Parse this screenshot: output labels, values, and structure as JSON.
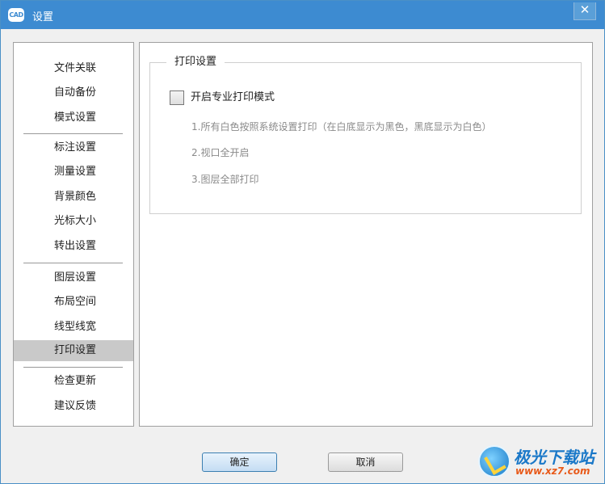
{
  "window": {
    "logo_text": "CAD",
    "title": "设置",
    "close_glyph": "✕"
  },
  "sidebar": {
    "groups": [
      [
        "文件关联",
        "自动备份",
        "模式设置"
      ],
      [
        "标注设置",
        "测量设置",
        "背景颜色",
        "光标大小",
        "转出设置"
      ],
      [
        "图层设置",
        "布局空间",
        "线型线宽",
        "打印设置"
      ],
      [
        "检查更新",
        "建议反馈"
      ]
    ],
    "items": [
      {
        "label": "文件关联",
        "id": "file-association"
      },
      {
        "label": "自动备份",
        "id": "auto-backup"
      },
      {
        "label": "模式设置",
        "id": "mode-settings"
      },
      {
        "label": "标注设置",
        "id": "annotation-settings"
      },
      {
        "label": "测量设置",
        "id": "measure-settings"
      },
      {
        "label": "背景颜色",
        "id": "background-color"
      },
      {
        "label": "光标大小",
        "id": "cursor-size"
      },
      {
        "label": "转出设置",
        "id": "export-settings"
      },
      {
        "label": "图层设置",
        "id": "layer-settings"
      },
      {
        "label": "布局空间",
        "id": "layout-space"
      },
      {
        "label": "线型线宽",
        "id": "linetype-lineweight"
      },
      {
        "label": "打印设置",
        "id": "print-settings"
      },
      {
        "label": "检查更新",
        "id": "check-update"
      },
      {
        "label": "建议反馈",
        "id": "feedback"
      }
    ],
    "active": "打印设置"
  },
  "print_settings": {
    "group_title": "打印设置",
    "checkbox_label": "开启专业打印模式",
    "checkbox_checked": false,
    "hints": [
      "1.所有白色按照系统设置打印（在白底显示为黑色，黑底显示为白色）",
      "2.视口全开启",
      "3.图层全部打印"
    ]
  },
  "footer": {
    "ok_label": "确定",
    "cancel_label": "取消"
  },
  "watermark": {
    "name": "极光下载站",
    "url": "www.xz7.com"
  },
  "colors": {
    "titlebar": "#3d8bd1",
    "active_item": "#c9c9c9",
    "hint_text": "#8a8a8a",
    "watermark_name": "#1a78c8",
    "watermark_url": "#e85a1a"
  }
}
